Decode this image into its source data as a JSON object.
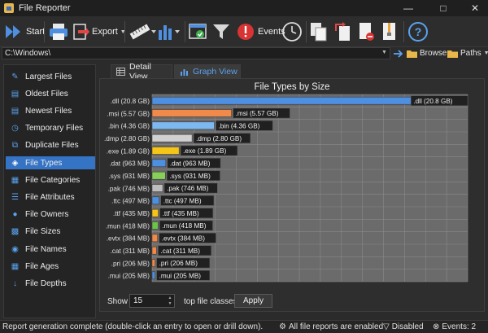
{
  "window": {
    "title": "File Reporter"
  },
  "toolbar": {
    "start_label": "Start",
    "export_label": "Export",
    "events_label": "Events",
    "browse_label": "Browse",
    "paths_label": "Paths"
  },
  "path": {
    "value": "C:\\Windows\\"
  },
  "sidebar": {
    "items": [
      {
        "label": "Largest Files",
        "icon": "ruler-icon"
      },
      {
        "label": "Oldest Files",
        "icon": "document-icon"
      },
      {
        "label": "Newest Files",
        "icon": "document-icon"
      },
      {
        "label": "Temporary Files",
        "icon": "clock-icon"
      },
      {
        "label": "Duplicate Files",
        "icon": "copy-icon"
      },
      {
        "label": "File Types",
        "icon": "tag-icon"
      },
      {
        "label": "File Categories",
        "icon": "folder-icon"
      },
      {
        "label": "File Attributes",
        "icon": "list-icon"
      },
      {
        "label": "File Owners",
        "icon": "user-icon"
      },
      {
        "label": "File Sizes",
        "icon": "bars-icon"
      },
      {
        "label": "File Names",
        "icon": "users-icon"
      },
      {
        "label": "File Ages",
        "icon": "calendar-icon"
      },
      {
        "label": "File Depths",
        "icon": "arrow-down-icon"
      }
    ],
    "active_index": 5
  },
  "tabs": [
    {
      "label": "Detail View",
      "active": false
    },
    {
      "label": "Graph View",
      "active": true
    }
  ],
  "chart_data": {
    "type": "bar",
    "orientation": "horizontal",
    "title": "File Types by Size",
    "categories": [
      ".dll (20.8 GB)",
      ".msi (5.57 GB)",
      ".bin (4.36 GB)",
      ".dmp (2.80 GB)",
      ".exe (1.89 GB)",
      ".dat (963 MB)",
      ".sys (931 MB)",
      ".pak (746 MB)",
      ".ttc (497 MB)",
      ".ttf (435 MB)",
      ".mun (418 MB)",
      ".evtx (384 MB)",
      ".cat (311 MB)",
      ".pri (206 MB)",
      ".mui (205 MB)"
    ],
    "value_labels": [
      ".dll (20.8 GB)",
      ".msi (5.57 GB)",
      ".bin (4.36 GB)",
      ".dmp (2.80 GB)",
      ".exe (1.89 GB)",
      ".dat (963 MB)",
      ".sys (931 MB)",
      ".pak (746 MB)",
      ".ttc (497 MB)",
      ".ttf (435 MB)",
      ".mun (418 MB)",
      ".evtx (384 MB)",
      ".cat (311 MB)",
      ".pri (206 MB)",
      ".mui (205 MB)"
    ],
    "values": [
      20.8,
      5.57,
      4.36,
      2.8,
      1.89,
      0.963,
      0.931,
      0.746,
      0.497,
      0.435,
      0.418,
      0.384,
      0.311,
      0.206,
      0.205
    ],
    "unit": "GB",
    "colors": [
      "#4f8fe0",
      "#f08a4b",
      "#7db8f0",
      "#d0d0d0",
      "#f5c518",
      "#4f8fe0",
      "#86d05a",
      "#bdbdbd",
      "#4f8fe0",
      "#f5c518",
      "#6dc24b",
      "#f08a4b",
      "#f08a4b",
      "#f08a4b",
      "#4f8fe0"
    ],
    "xlim": [
      0,
      20.8
    ],
    "grid": true,
    "legend": "none"
  },
  "controls": {
    "show_label": "Show",
    "show_value": "15",
    "classes_label": "top file classes",
    "apply_label": "Apply"
  },
  "status": {
    "message": "Report generation complete (double-click an entry to open or drill down).",
    "reports_enabled": "All file reports are enabled",
    "disabled": "Disabled",
    "events": "Events: 2"
  }
}
